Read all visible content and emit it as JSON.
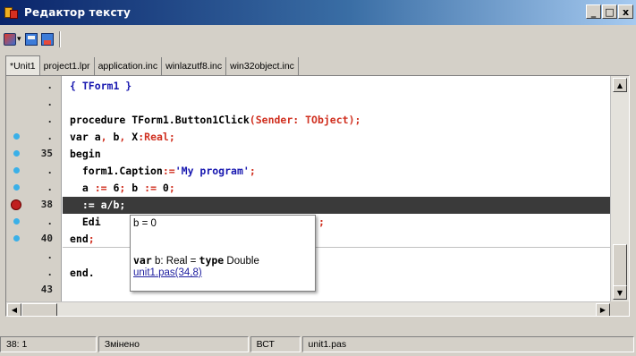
{
  "window": {
    "title": "Редактор тексту",
    "buttons": [
      "_",
      "□",
      "x"
    ]
  },
  "toolbar": {
    "run_icon": "run-icon",
    "dropdown_glyph": "▾",
    "open_icon": "open-icon",
    "save_icon": "save-icon"
  },
  "tabs": [
    {
      "label": "*Unit1",
      "active": true
    },
    {
      "label": "project1.lpr",
      "active": false
    },
    {
      "label": "application.inc",
      "active": false
    },
    {
      "label": "winlazutf8.inc",
      "active": false
    },
    {
      "label": "win32object.inc",
      "active": false
    }
  ],
  "gutter": [
    {
      "marker": "none",
      "num": "."
    },
    {
      "marker": "none",
      "num": "."
    },
    {
      "marker": "none",
      "num": "."
    },
    {
      "marker": "dot",
      "num": "."
    },
    {
      "marker": "dot",
      "num": "35"
    },
    {
      "marker": "dot",
      "num": "."
    },
    {
      "marker": "dot",
      "num": "."
    },
    {
      "marker": "breakpoint",
      "num": "38"
    },
    {
      "marker": "dot",
      "num": "."
    },
    {
      "marker": "dot",
      "num": "40"
    },
    {
      "marker": "none",
      "num": "."
    },
    {
      "marker": "none",
      "num": "."
    },
    {
      "marker": "none",
      "num": "43"
    }
  ],
  "code": {
    "l0": "{ TForm1 }",
    "l2_a": "procedure TForm1.Button1Click",
    "l2_b": "(Sender: TObject);",
    "l3_a": "var a",
    "l3_b": ", ",
    "l3_c": "b",
    "l3_d": ", ",
    "l3_e": "X",
    "l3_f": ":Real;",
    "l4": "begin",
    "l5_a": "  form1.Caption",
    "l5_b": ":=",
    "l5_c": "'My program'",
    "l5_d": ";",
    "l6_a": "  a ",
    "l6_b": ":=",
    "l6_c": " 6",
    "l6_d": "; ",
    "l6_e": "b ",
    "l6_f": ":=",
    "l6_g": " 0",
    "l6_h": ";",
    "l7": "  := a/b;",
    "l8_a": "  Edi",
    "l8_b": ";",
    "l9_a": "end",
    "l9_b": ";",
    "l11": "end."
  },
  "hint": {
    "top": "b = 0",
    "decl_kw": "var",
    "decl_mid": " b: Real = ",
    "decl_type": "type",
    "decl_end": " Double",
    "link": "unit1.pas(34,8)"
  },
  "status": {
    "position": "38:  1",
    "modified": "Змінено",
    "mode": "ВСТ",
    "file": "unit1.pas"
  },
  "colors": {
    "title_start": "#0a246a",
    "title_end": "#a6caf0",
    "symbol_red": "#d03020",
    "string_blue": "#1818b0",
    "exec_line": "#3a3a3a",
    "breakpoint": "#c02020",
    "gutter_dot": "#3ab0e8",
    "change_mark": "#e2c035"
  }
}
